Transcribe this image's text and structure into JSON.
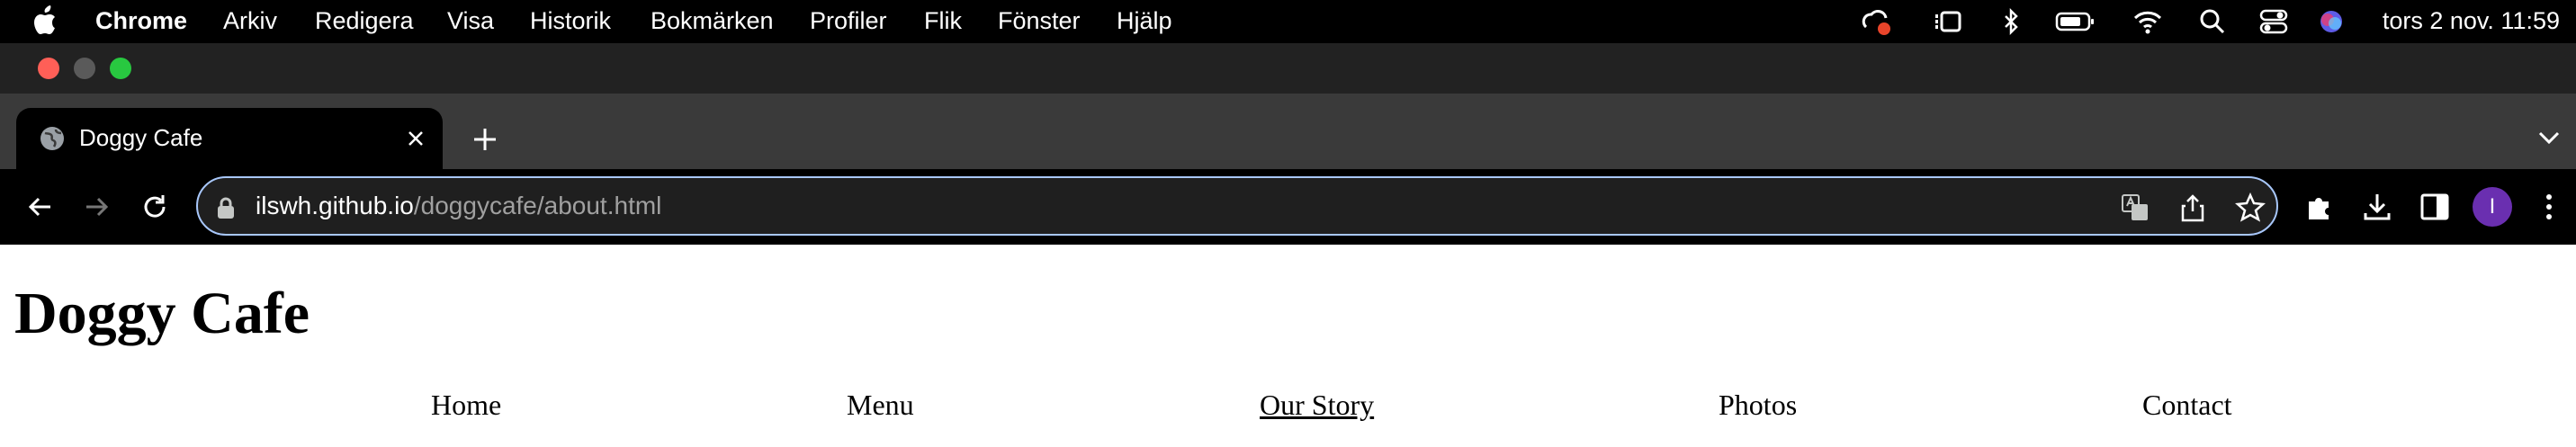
{
  "menubar": {
    "app_name": "Chrome",
    "items": [
      "Arkiv",
      "Redigera",
      "Visa",
      "Historik",
      "Bokmärken",
      "Profiler",
      "Flik",
      "Fönster",
      "Hjälp"
    ],
    "clock": "tors 2 nov. 11:59",
    "status_icons": [
      "creative-cloud-icon",
      "stage-manager-icon",
      "bluetooth-icon",
      "battery-icon",
      "wifi-icon",
      "spotlight-search-icon",
      "control-center-icon",
      "siri-icon"
    ]
  },
  "tab": {
    "title": "Doggy Cafe"
  },
  "toolbar": {
    "url_host": "ilswh.github.io",
    "url_path": "/doggycafe/about.html",
    "profile_initial": "I"
  },
  "colors": {
    "close": "#ff5f57",
    "minimize": "#5a5a5a",
    "maximize": "#28c840",
    "avatar": "#6a2fb0",
    "omnibox_border": "#a8c7fa"
  },
  "page": {
    "title": "Doggy Cafe",
    "nav": [
      "Home",
      "Menu",
      "Our Story",
      "Photos",
      "Contact"
    ],
    "active_nav": "Our Story"
  }
}
